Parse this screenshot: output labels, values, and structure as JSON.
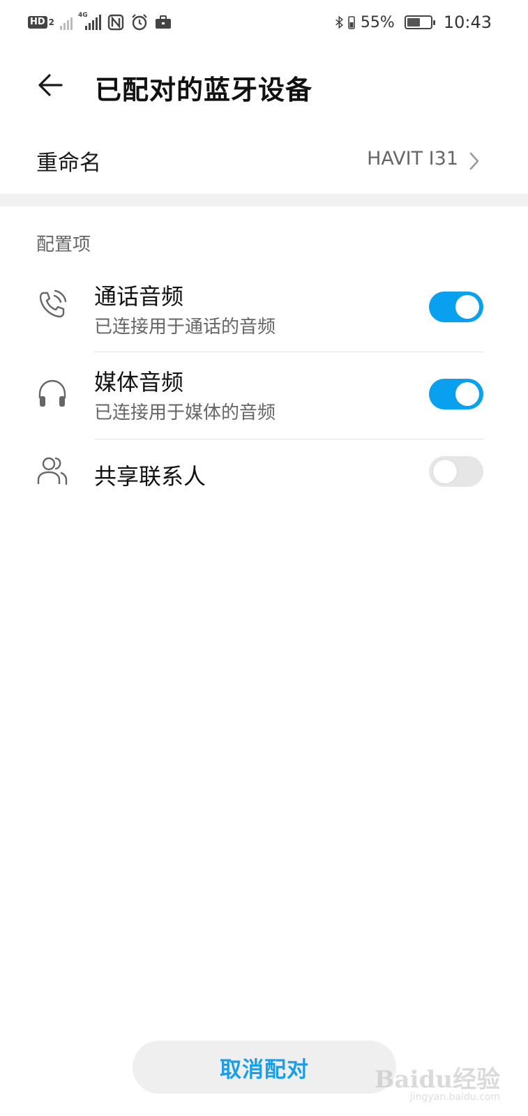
{
  "status_bar": {
    "hd_label": "HD",
    "hd_sub": "2",
    "network_tag": "4G",
    "battery_percent_text": "55%",
    "battery_level": 0.55,
    "time": "10:43"
  },
  "header": {
    "title": "已配对的蓝牙设备"
  },
  "rename": {
    "label": "重命名",
    "value": "HAVIT I31"
  },
  "config": {
    "section_title": "配置项",
    "items": [
      {
        "title": "通话音频",
        "subtitle": "已连接用于通话的音频",
        "icon": "phone-call-icon",
        "enabled": true
      },
      {
        "title": "媒体音频",
        "subtitle": "已连接用于媒体的音频",
        "icon": "headphones-icon",
        "enabled": true
      },
      {
        "title": "共享联系人",
        "subtitle": "",
        "icon": "contacts-icon",
        "enabled": false
      }
    ]
  },
  "footer": {
    "unpair_label": "取消配对"
  },
  "watermark": {
    "main": "Baidu经验",
    "sub": "jingyan.baidu.com"
  },
  "colors": {
    "accent": "#0aa0f0",
    "accent_text": "#1a9ee6",
    "toggle_off": "#e6e6e6"
  }
}
